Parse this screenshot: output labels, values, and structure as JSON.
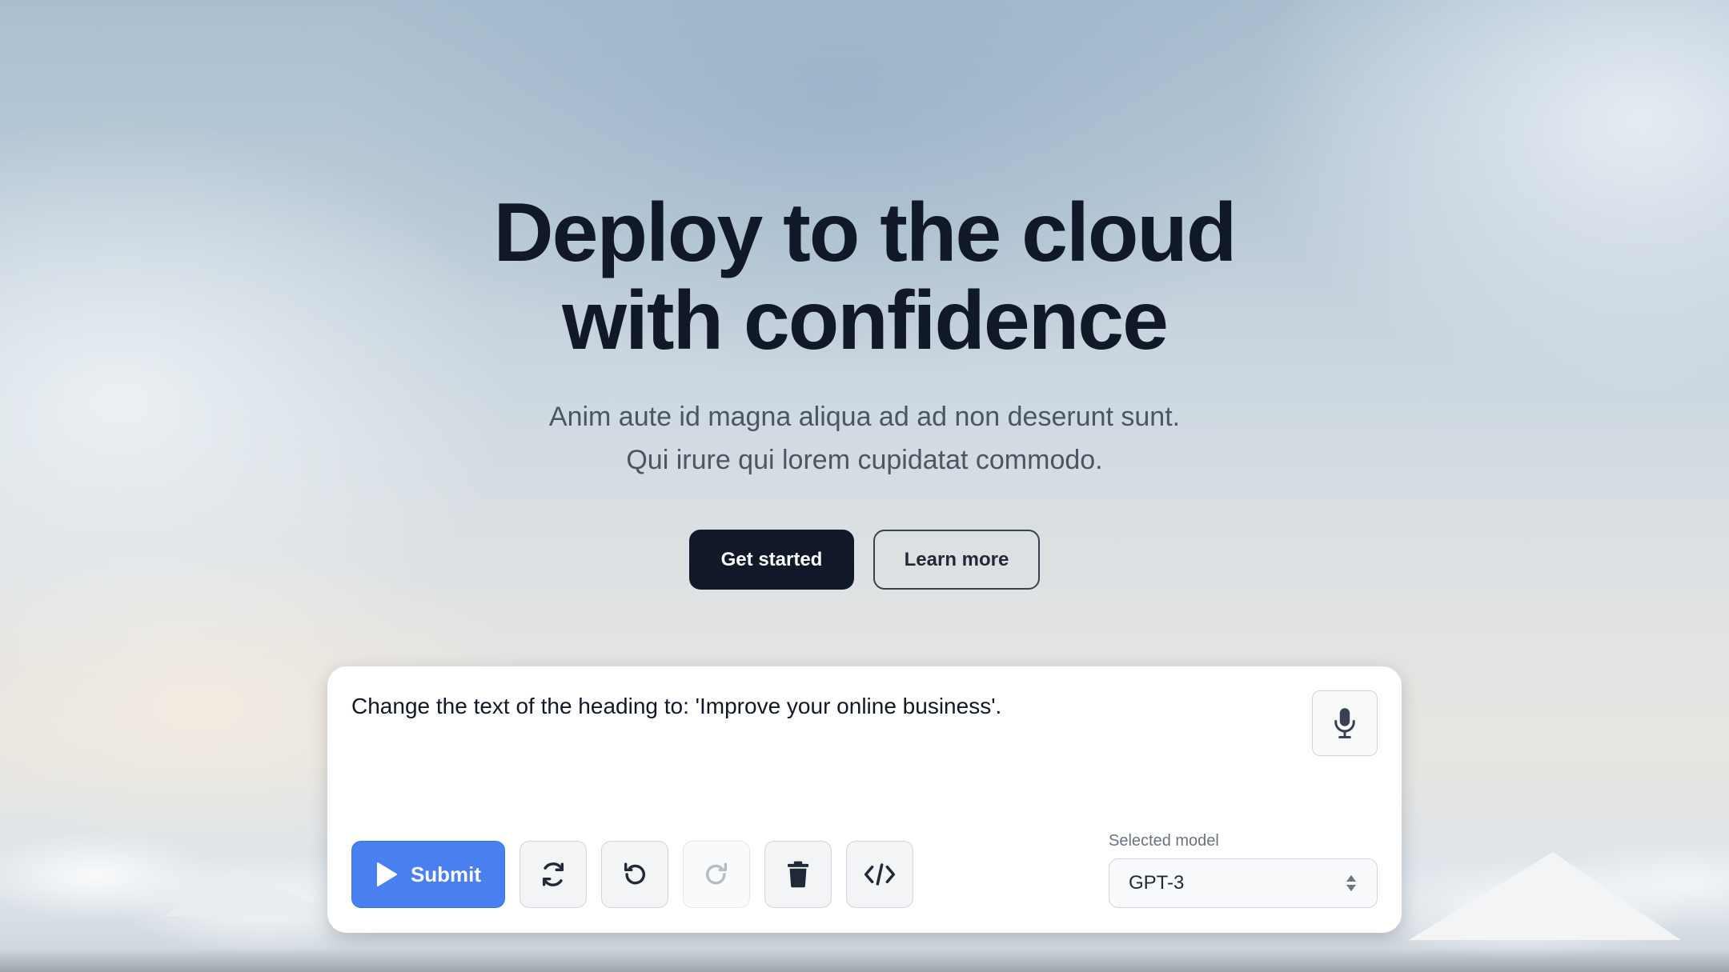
{
  "hero": {
    "heading_line1": "Deploy to the cloud",
    "heading_line2": "with confidence",
    "subtitle_line1": "Anim aute id magna aliqua ad ad non deserunt sunt.",
    "subtitle_line2": "Qui irure qui lorem cupidatat commodo.",
    "primary_cta": "Get started",
    "secondary_cta": "Learn more"
  },
  "editor": {
    "prompt_text": "Change the text of the heading to: 'Improve your online business'.",
    "mic_icon": "microphone-icon",
    "submit_label": "Submit",
    "submit_icon": "play-icon",
    "tools": [
      {
        "name": "regenerate",
        "icon": "refresh-icon",
        "enabled": true
      },
      {
        "name": "undo",
        "icon": "undo-icon",
        "enabled": true
      },
      {
        "name": "redo",
        "icon": "redo-icon",
        "enabled": false
      },
      {
        "name": "delete",
        "icon": "trash-icon",
        "enabled": true
      },
      {
        "name": "view-code",
        "icon": "code-icon",
        "enabled": true
      }
    ],
    "model_label": "Selected model",
    "model_value": "GPT-3"
  },
  "colors": {
    "heading": "#111827",
    "primary_button": "#111827",
    "submit_button": "#4a7ff0",
    "subtitle": "#4b5563"
  }
}
